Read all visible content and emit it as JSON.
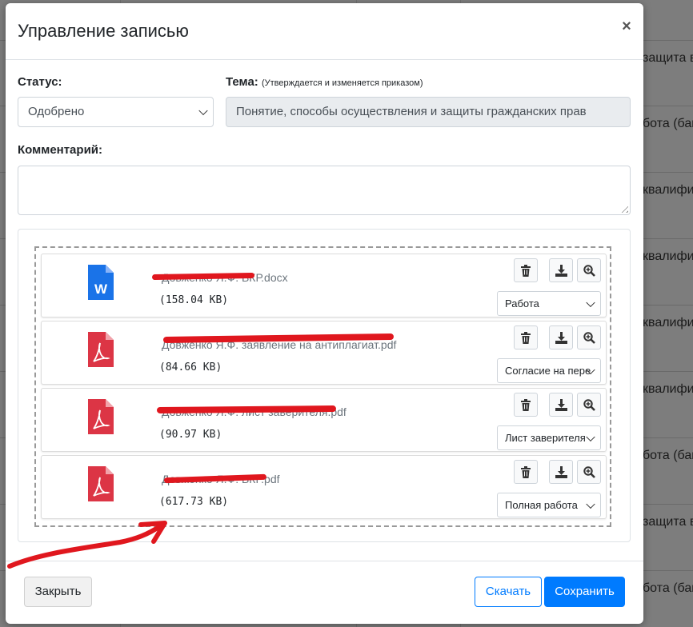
{
  "background": {
    "right_fragments": [
      "защита в",
      "бота (бак",
      "квалифи",
      "квалифи",
      "квалифи",
      "квалифи",
      "бота (бак",
      "защита в",
      "бота (бак"
    ]
  },
  "modal": {
    "title": "Управление записью",
    "close_symbol": "×",
    "status": {
      "label": "Статус:",
      "value": "Одобрено"
    },
    "topic": {
      "label": "Тема:",
      "hint": "(Утверждается и изменяется приказом)",
      "value": "Понятие, способы осуществления и защиты гражданских прав"
    },
    "comment": {
      "label": "Комментарий:",
      "value": ""
    },
    "files": [
      {
        "name": "Довженко Я.Ф. ВКР.docx",
        "size": "(158.04 KB)",
        "type": "word",
        "category": "Работа"
      },
      {
        "name": "Довженко Я.Ф. заявление на антиплагиат.pdf",
        "size": "(84.66 KB)",
        "type": "pdf",
        "category": "Согласие на пере"
      },
      {
        "name": "Довженко Я.Ф. лист заверителя.pdf",
        "size": "(90.97 KB)",
        "type": "pdf",
        "category": "Лист заверителя"
      },
      {
        "name": "Довженко Я.Ф. ВКР.pdf",
        "size": "(617.73 KB)",
        "type": "pdf",
        "category": "Полная работа"
      }
    ],
    "footer": {
      "close_label": "Закрыть",
      "download_label": "Скачать",
      "save_label": "Сохранить"
    }
  },
  "colors": {
    "primary": "#007bff",
    "pdf": "#dc3545",
    "word": "#1a73e8",
    "annotation": "#e0171e"
  }
}
